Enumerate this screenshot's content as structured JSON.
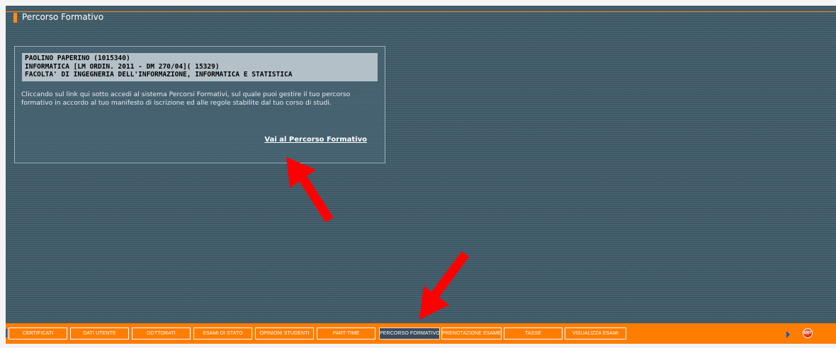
{
  "page": {
    "title": "Percorso Formativo"
  },
  "student": {
    "line1": "PAOLINO PAPERINO (1015340)",
    "line2": "INFORMATICA [LM ORDIN. 2011 - DM 270/04]( 15329)",
    "line3": "FACOLTA' DI INGEGNERIA DELL'INFORMAZIONE, INFORMATICA E STATISTICA"
  },
  "description": "Cliccando sul link qui sotto accedi al sistema Percorsi Formativi, sul quale puoi gestire il tuo percorso formativo in accordo al tuo manifesto di iscrizione ed alle regole stabilite dal tuo corso di studi.",
  "link_label": "Vai al Percorso Formativo",
  "toolbar": {
    "tabs": [
      {
        "label": "CERTIFICATI"
      },
      {
        "label": "DATI UTENTE"
      },
      {
        "label": "DOTTORATI"
      },
      {
        "label": "ESAMI DI STATO"
      },
      {
        "label": "OPINIONI STUDENTI"
      },
      {
        "label": "PART-TIME"
      },
      {
        "label": "PERCORSO FORMATIVO",
        "active": true
      },
      {
        "label": "PRENOTAZIONE ESAME"
      },
      {
        "label": "TASSE"
      },
      {
        "label": "VISUALIZZA ESAMI"
      }
    ],
    "next_icon": "triangle-right",
    "exit_label": "EXIT"
  },
  "colors": {
    "accent": "#ff7d00",
    "background": "#3f5a68",
    "arrow": "#ff0000"
  }
}
